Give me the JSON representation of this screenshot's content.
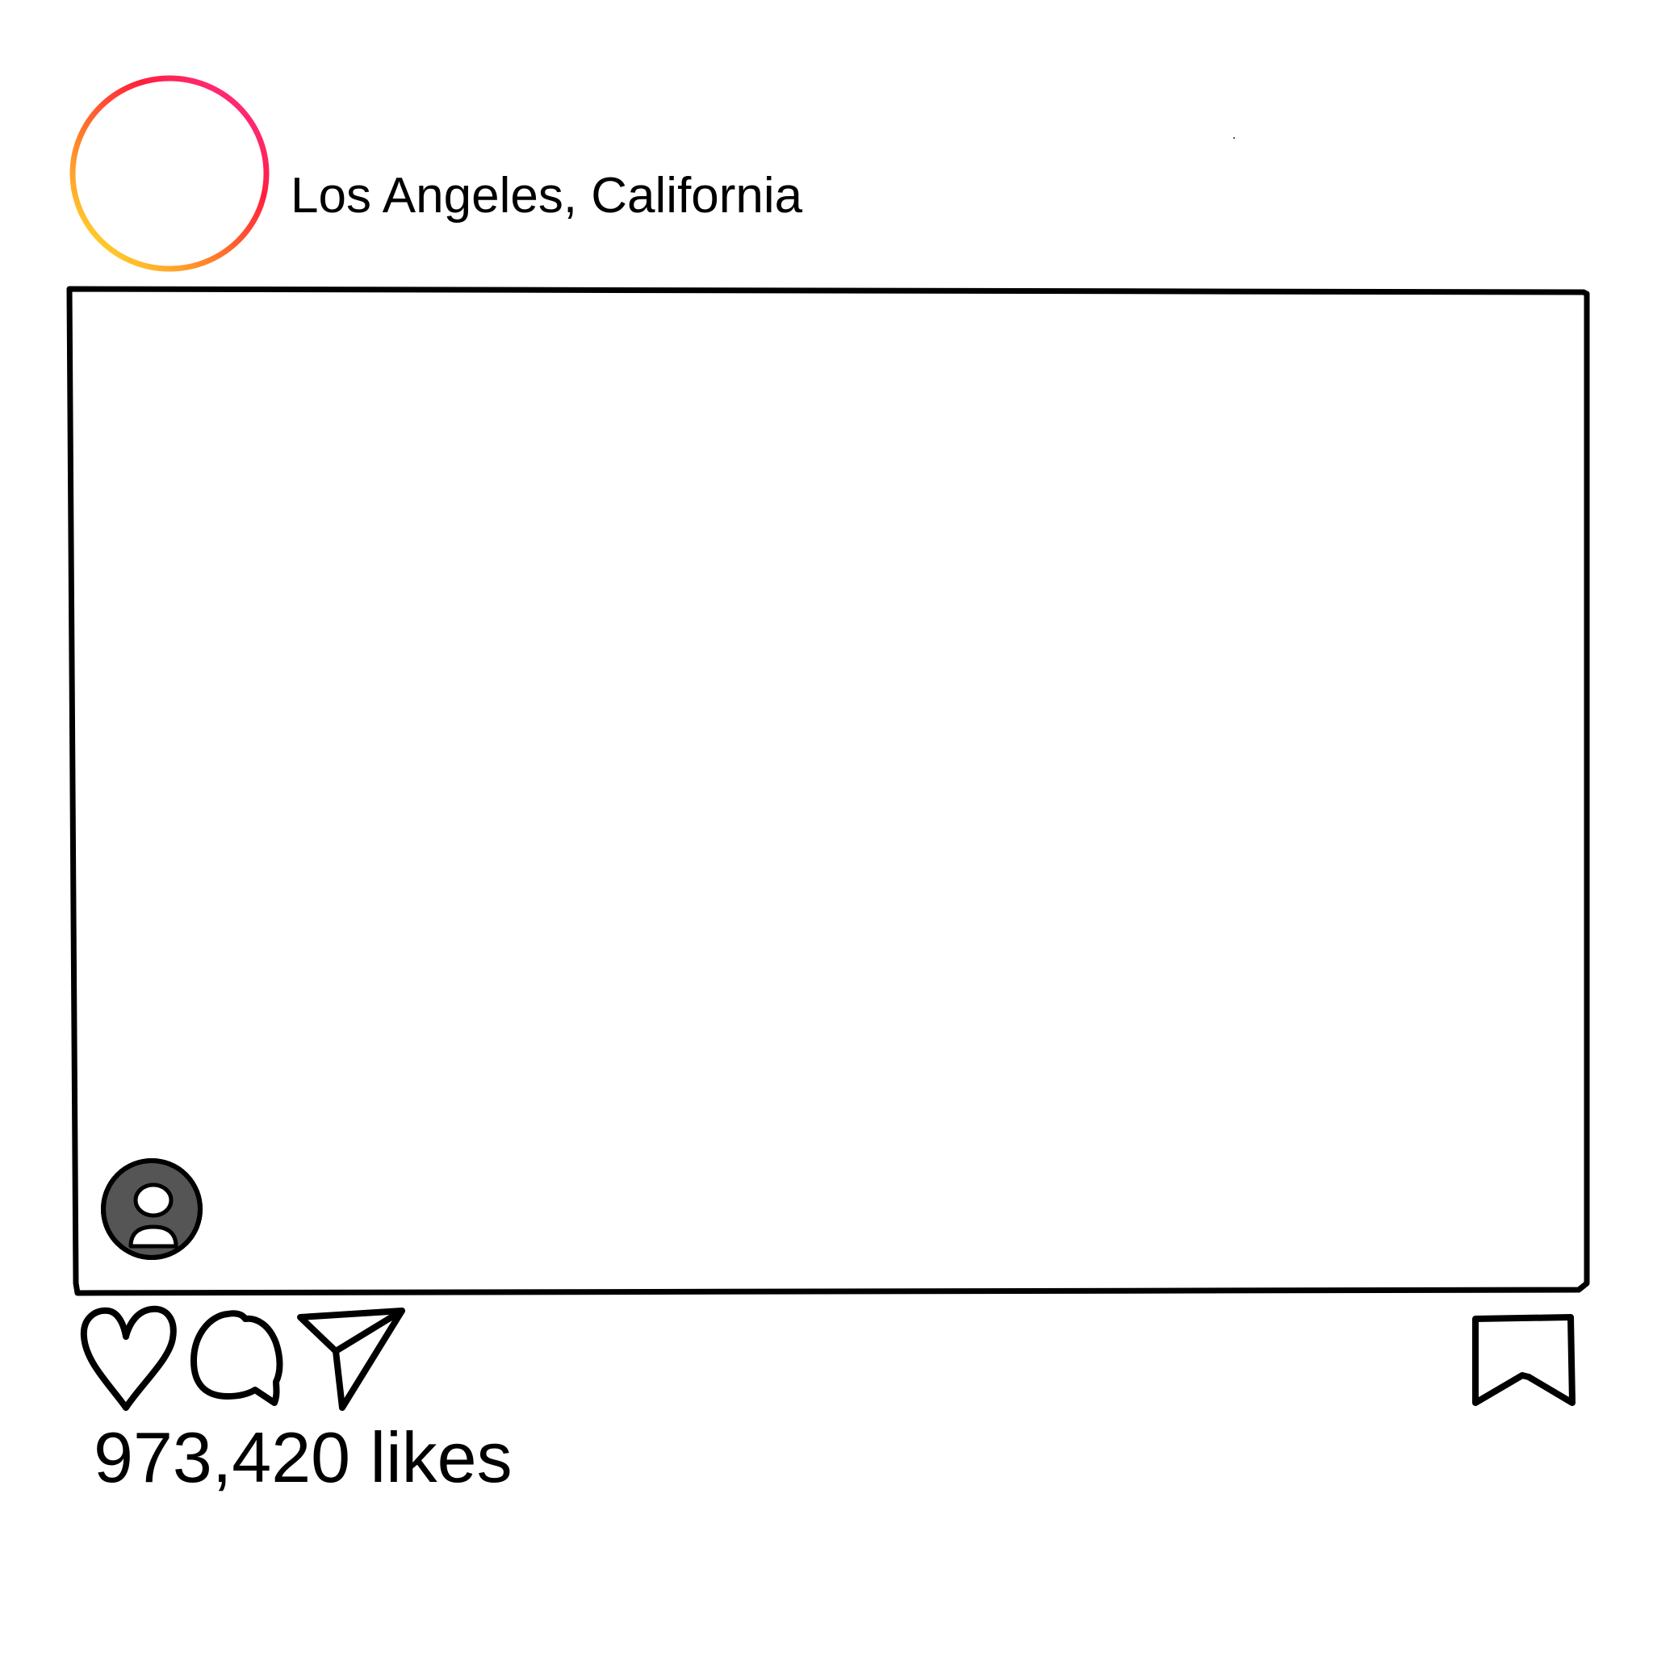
{
  "post": {
    "location": "Los Angeles, California",
    "likes_text": "973,420 likes"
  },
  "icons": {
    "profile": "profile-ring-icon",
    "tag": "tagged-user-icon",
    "like": "heart-icon",
    "comment": "comment-bubble-icon",
    "share": "paper-plane-icon",
    "save": "bookmark-icon"
  },
  "colors": {
    "ring_gradient": [
      "#FFD52C",
      "#FF7A2A",
      "#FF1F3C",
      "#FF2D8A"
    ],
    "stroke": "#000000",
    "tag_fill": "#555555",
    "background": "#FFFFFF"
  }
}
